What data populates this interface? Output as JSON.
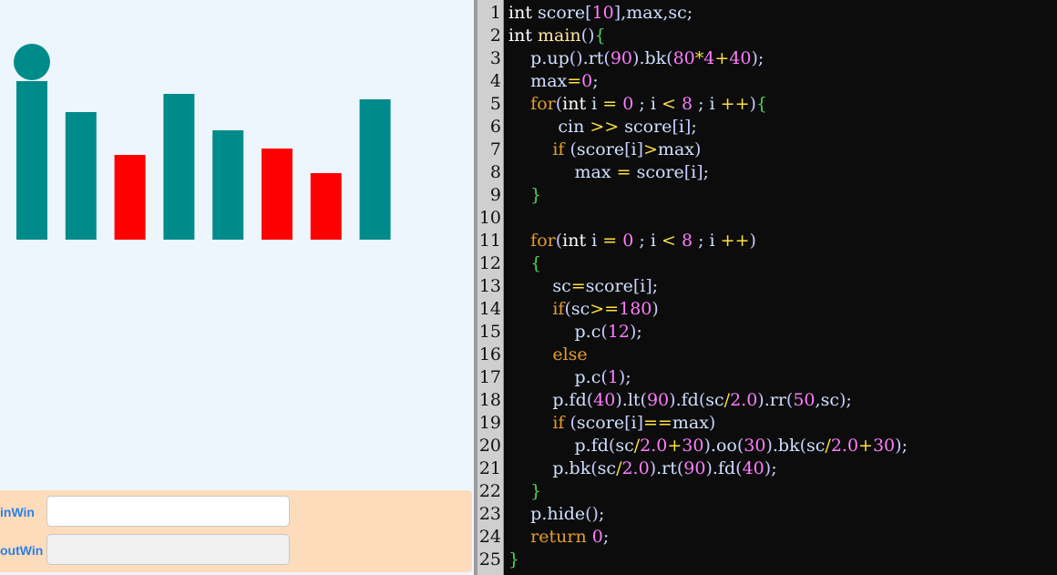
{
  "canvas": {
    "bar_color": "#008b8b",
    "low_color": "#ff0000",
    "bar_heights": [
      174,
      140,
      93,
      160,
      120,
      100,
      73,
      154
    ],
    "bar_colors": [
      "teal",
      "teal",
      "red",
      "teal",
      "teal",
      "red",
      "red",
      "teal"
    ],
    "dot_on_bar": 0
  },
  "io": {
    "in_label": "inWin",
    "out_label": "outWin",
    "in_value": "",
    "out_value": ""
  },
  "editor": {
    "theme": {
      "background": "#0c0c0c",
      "gutter": "#cfcfcf"
    },
    "lines": [
      "int score[10],max,sc;",
      "int main(){",
      "    p.up().rt(90).bk(80*4+40);",
      "    max=0;",
      "    for(int i = 0 ; i < 8 ; i ++){",
      "         cin >> score[i];",
      "        if (score[i]>max)",
      "            max = score[i];",
      "    }",
      "",
      "    for(int i = 0 ; i < 8 ; i ++)",
      "    {",
      "        sc=score[i];",
      "        if(sc>=180)",
      "            p.c(12);",
      "        else",
      "            p.c(1);",
      "        p.fd(40).lt(90).fd(sc/2.0).rr(50,sc);",
      "        if (score[i]==max)",
      "            p.fd(sc/2.0+30).oo(30).bk(sc/2.0+30);",
      "        p.bk(sc/2.0).rt(90).fd(40);",
      "    }",
      "    p.hide();",
      "    return 0;",
      "}"
    ]
  }
}
